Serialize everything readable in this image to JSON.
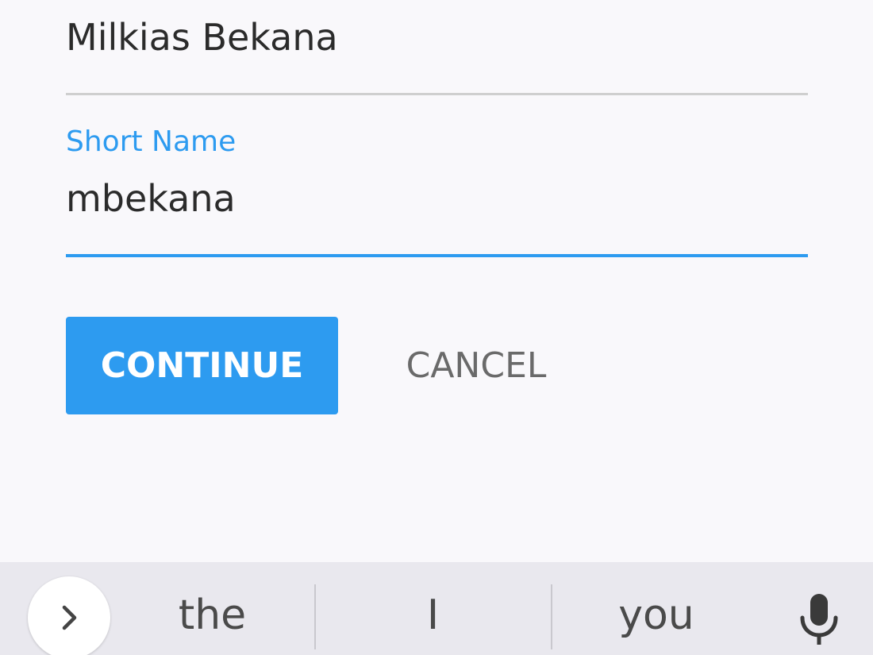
{
  "form": {
    "full_name_value": "Milkias Bekana",
    "short_name_label": "Short Name",
    "short_name_value": "mbekana",
    "accent_color": "#2d9bf0"
  },
  "actions": {
    "continue_label": "CONTINUE",
    "cancel_label": "CANCEL"
  },
  "keyboard": {
    "expand_icon": "chevron-right-icon",
    "suggestions": [
      "the",
      "I",
      "you"
    ],
    "mic_icon": "microphone-icon"
  }
}
